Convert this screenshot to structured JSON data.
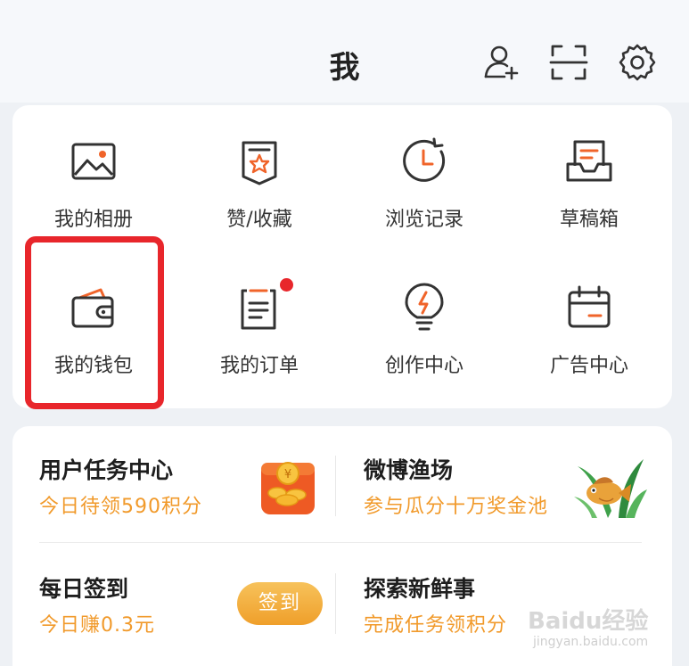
{
  "header": {
    "title": "我"
  },
  "grid": {
    "items": [
      {
        "label": "我的相册",
        "icon": "photo-album-icon"
      },
      {
        "label": "赞/收藏",
        "icon": "like-favorite-icon"
      },
      {
        "label": "浏览记录",
        "icon": "history-clock-icon"
      },
      {
        "label": "草稿箱",
        "icon": "drafts-inbox-icon"
      },
      {
        "label": "我的钱包",
        "icon": "wallet-icon"
      },
      {
        "label": "我的订单",
        "icon": "orders-icon"
      },
      {
        "label": "创作中心",
        "icon": "lightbulb-icon"
      },
      {
        "label": "广告中心",
        "icon": "calendar-icon"
      }
    ]
  },
  "tasks": {
    "task_center": {
      "title": "用户任务中心",
      "subtitle": "今日待领590积分"
    },
    "fishing": {
      "title": "微博渔场",
      "subtitle": "参与瓜分十万奖金池"
    },
    "checkin": {
      "title": "每日签到",
      "subtitle": "今日赚0.3元",
      "button": "签到"
    },
    "explore": {
      "title": "探索新鲜事",
      "subtitle": "完成任务领积分"
    }
  },
  "watermark": {
    "logo": "Baidu经验",
    "url": "jingyan.baidu.com"
  },
  "colors": {
    "accent": "#f19a2b",
    "highlight": "#e8262b",
    "icon": "#333333",
    "icon_accent": "#f0642a"
  }
}
